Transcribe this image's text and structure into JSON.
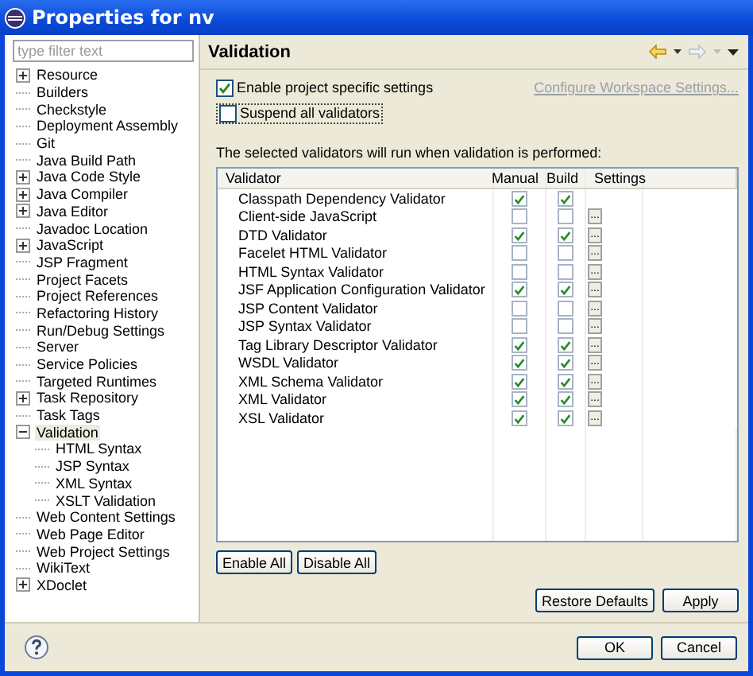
{
  "window": {
    "title": "Properties for nv"
  },
  "filter": {
    "placeholder": "type filter text"
  },
  "tree": [
    {
      "label": "Resource",
      "kind": "folder",
      "expanded": false,
      "selected": false
    },
    {
      "label": "Builders",
      "kind": "leaf",
      "selected": false
    },
    {
      "label": "Checkstyle",
      "kind": "leaf",
      "selected": false
    },
    {
      "label": "Deployment Assembly",
      "kind": "leaf",
      "selected": false
    },
    {
      "label": "Git",
      "kind": "leaf",
      "selected": false
    },
    {
      "label": "Java Build Path",
      "kind": "leaf",
      "selected": false
    },
    {
      "label": "Java Code Style",
      "kind": "folder",
      "expanded": false,
      "selected": false
    },
    {
      "label": "Java Compiler",
      "kind": "folder",
      "expanded": false,
      "selected": false
    },
    {
      "label": "Java Editor",
      "kind": "folder",
      "expanded": false,
      "selected": false
    },
    {
      "label": "Javadoc Location",
      "kind": "leaf",
      "selected": false
    },
    {
      "label": "JavaScript",
      "kind": "folder",
      "expanded": false,
      "selected": false
    },
    {
      "label": "JSP Fragment",
      "kind": "leaf",
      "selected": false
    },
    {
      "label": "Project Facets",
      "kind": "leaf",
      "selected": false
    },
    {
      "label": "Project References",
      "kind": "leaf",
      "selected": false
    },
    {
      "label": "Refactoring History",
      "kind": "leaf",
      "selected": false
    },
    {
      "label": "Run/Debug Settings",
      "kind": "leaf",
      "selected": false
    },
    {
      "label": "Server",
      "kind": "leaf",
      "selected": false
    },
    {
      "label": "Service Policies",
      "kind": "leaf",
      "selected": false
    },
    {
      "label": "Targeted Runtimes",
      "kind": "leaf",
      "selected": false
    },
    {
      "label": "Task Repository",
      "kind": "folder",
      "expanded": false,
      "selected": false
    },
    {
      "label": "Task Tags",
      "kind": "leaf",
      "selected": false
    },
    {
      "label": "Validation",
      "kind": "folder",
      "expanded": true,
      "selected": true,
      "children": [
        {
          "label": "HTML Syntax",
          "selected": false
        },
        {
          "label": "JSP Syntax",
          "selected": false
        },
        {
          "label": "XML Syntax",
          "selected": false
        },
        {
          "label": "XSLT Validation",
          "selected": false
        }
      ]
    },
    {
      "label": "Web Content Settings",
      "kind": "leaf",
      "selected": false
    },
    {
      "label": "Web Page Editor",
      "kind": "leaf",
      "selected": false
    },
    {
      "label": "Web Project Settings",
      "kind": "leaf",
      "selected": false
    },
    {
      "label": "WikiText",
      "kind": "leaf",
      "selected": false
    },
    {
      "label": "XDoclet",
      "kind": "folder",
      "expanded": false,
      "selected": false
    }
  ],
  "page": {
    "title": "Validation",
    "enable_specific": {
      "label": "Enable project specific settings",
      "checked": true
    },
    "configure_link": "Configure Workspace Settings...",
    "suspend_all": {
      "label": "Suspend all validators",
      "checked": false
    },
    "intro": "The selected validators will run when validation is performed:",
    "table": {
      "columns": [
        "Validator",
        "Manual",
        "Build",
        "Settings"
      ],
      "rows": [
        {
          "name": "Classpath Dependency Validator",
          "manual": true,
          "build": true
        },
        {
          "name": "Client-side JavaScript",
          "manual": false,
          "build": false,
          "settings": "..."
        },
        {
          "name": "DTD Validator",
          "manual": true,
          "build": true,
          "settings": "..."
        },
        {
          "name": "Facelet HTML Validator",
          "manual": false,
          "build": false,
          "settings": "..."
        },
        {
          "name": "HTML Syntax Validator",
          "manual": false,
          "build": false,
          "settings": "..."
        },
        {
          "name": "JSF Application Configuration Validator",
          "manual": true,
          "build": true,
          "settings": "..."
        },
        {
          "name": "JSP Content Validator",
          "manual": false,
          "build": false,
          "settings": "..."
        },
        {
          "name": "JSP Syntax Validator",
          "manual": false,
          "build": false,
          "settings": "..."
        },
        {
          "name": "Tag Library Descriptor Validator",
          "manual": true,
          "build": true,
          "settings": "..."
        },
        {
          "name": "WSDL Validator",
          "manual": true,
          "build": true,
          "settings": "..."
        },
        {
          "name": "XML Schema Validator",
          "manual": true,
          "build": true,
          "settings": "..."
        },
        {
          "name": "XML Validator",
          "manual": true,
          "build": true,
          "settings": "..."
        },
        {
          "name": "XSL Validator",
          "manual": true,
          "build": true,
          "settings": "..."
        }
      ]
    },
    "table_buttons": [
      "Enable All",
      "Disable All"
    ],
    "page_buttons": [
      "Restore Defaults",
      "Apply"
    ]
  },
  "dialog_buttons": [
    "OK",
    "Cancel"
  ]
}
